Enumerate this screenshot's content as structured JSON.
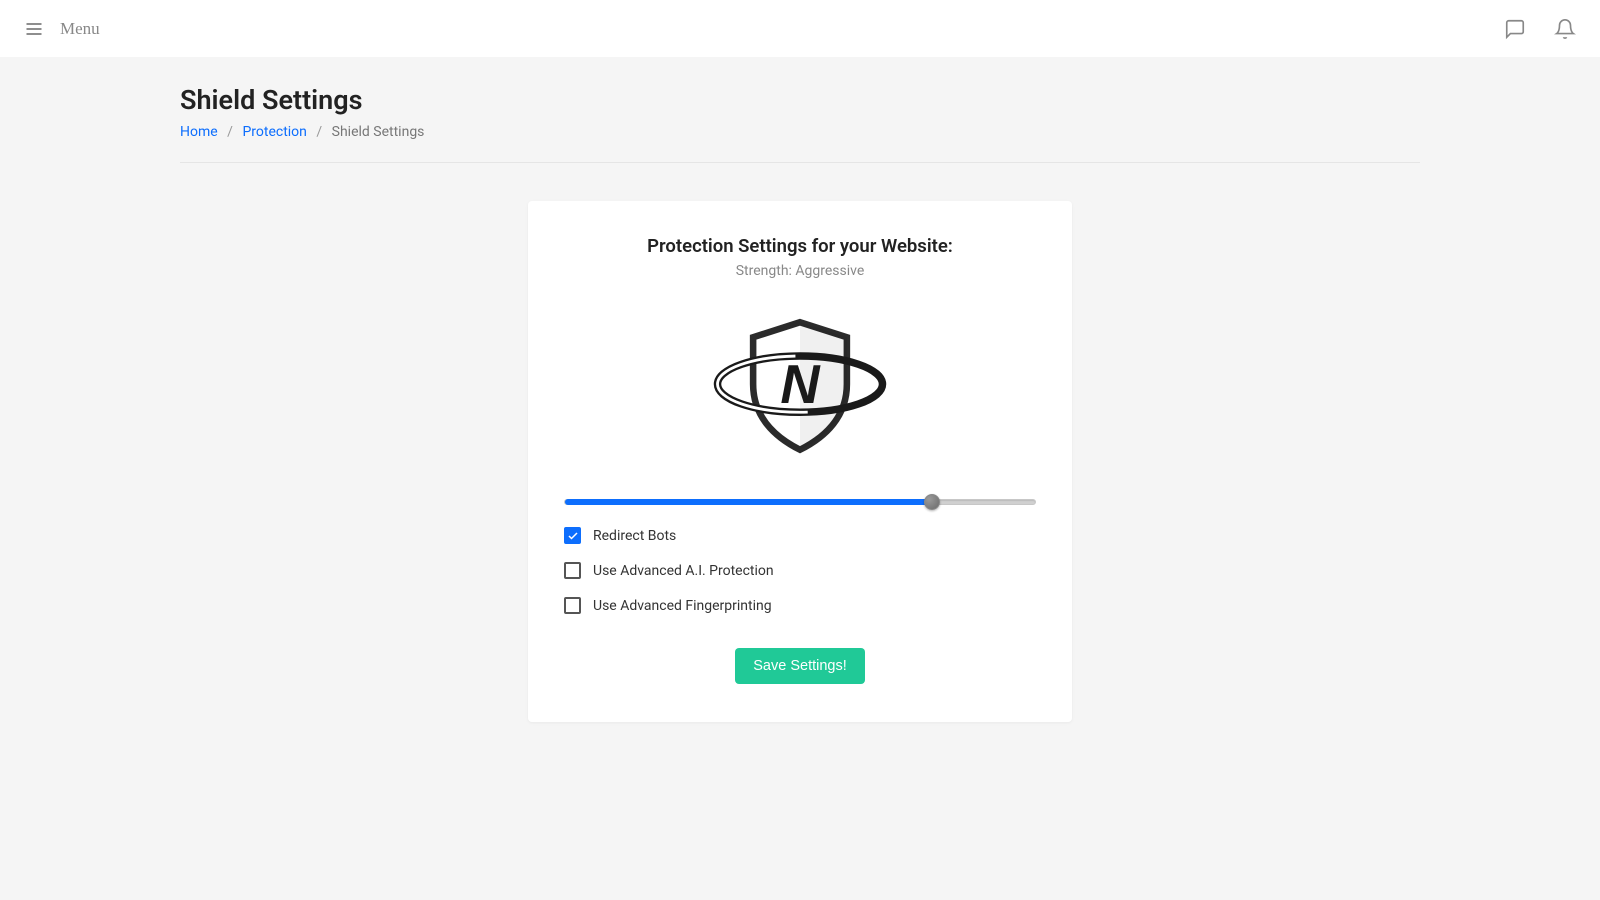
{
  "topbar": {
    "menu_label": "Menu"
  },
  "page": {
    "title": "Shield Settings"
  },
  "breadcrumb": {
    "home": "Home",
    "protection": "Protection",
    "current": "Shield Settings"
  },
  "card": {
    "title": "Protection Settings for your Website:",
    "subtitle_prefix": "Strength: ",
    "strength_label": "Aggressive",
    "slider_percent": 78,
    "checks": [
      {
        "label": "Redirect Bots",
        "checked": true
      },
      {
        "label": "Use Advanced A.I. Protection",
        "checked": false
      },
      {
        "label": "Use Advanced Fingerprinting",
        "checked": false
      }
    ],
    "save_label": "Save Settings!"
  }
}
